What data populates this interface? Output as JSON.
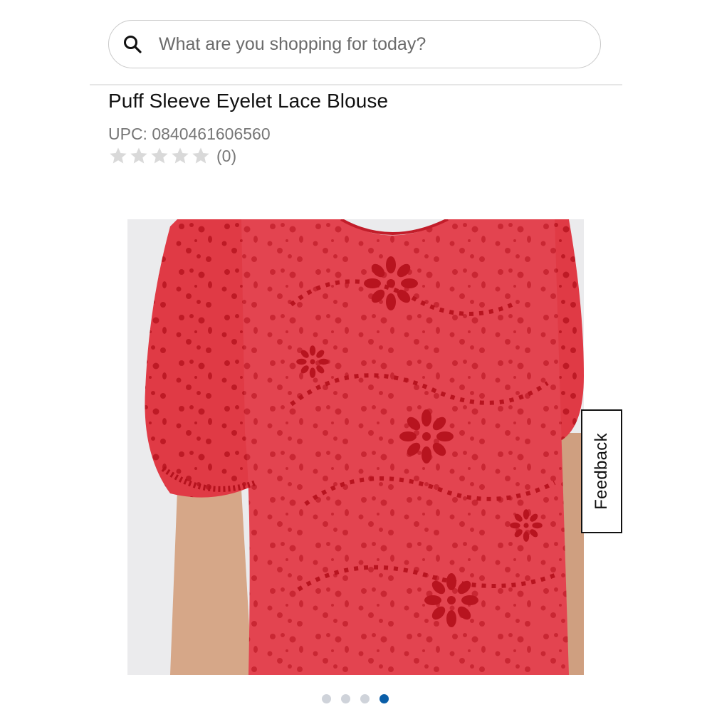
{
  "search": {
    "placeholder": "What are you shopping for today?",
    "icon": "search-icon"
  },
  "product": {
    "title": "Puff Sleeve Eyelet Lace Blouse",
    "upc": "UPC: 0840461606560",
    "rating": {
      "stars": 0,
      "max_stars": 5,
      "review_count": "(0)"
    },
    "image": {
      "description_icon": "product-photo",
      "fabric_color": "#e03a45"
    }
  },
  "feedback": {
    "label": "Feedback"
  },
  "carousel": {
    "total": 4,
    "active_index": 3,
    "active_color": "#0a5ea8",
    "inactive_color": "#cfd3da"
  }
}
